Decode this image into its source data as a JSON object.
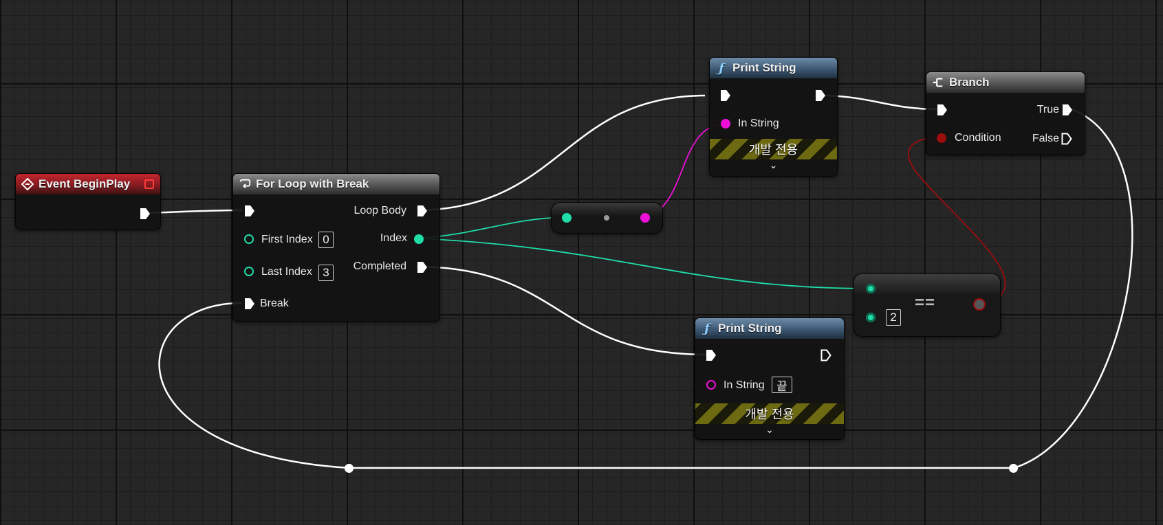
{
  "colors": {
    "exec": "#ffffff",
    "integer": "#1fdca8",
    "string": "#ee10d9",
    "boolean": "#9c0d0d",
    "event_header": "#b8232b",
    "function_header": "#3d5873"
  },
  "nodes": {
    "event_begin_play": {
      "title": "Event BeginPlay",
      "icon": "event-diamond-icon"
    },
    "for_loop": {
      "title": "For Loop with Break",
      "icon": "loop-icon",
      "loop_body": "Loop Body",
      "first_index_label": "First Index",
      "first_index_value": "0",
      "index": "Index",
      "last_index_label": "Last Index",
      "last_index_value": "3",
      "completed": "Completed",
      "break": "Break"
    },
    "print_string_1": {
      "title": "Print String",
      "icon": "function-icon",
      "in_string_label": "In String",
      "dev_only": "개발 전용"
    },
    "print_string_2": {
      "title": "Print String",
      "icon": "function-icon",
      "in_string_label": "In String",
      "in_string_value": "끝",
      "dev_only": "개발 전용"
    },
    "branch": {
      "title": "Branch",
      "icon": "branch-icon",
      "true_label": "True",
      "condition_label": "Condition",
      "false_label": "False"
    },
    "equal": {
      "operator": "==",
      "value_b": "2"
    },
    "to_string": {
      "icon": "convert-icon"
    }
  }
}
